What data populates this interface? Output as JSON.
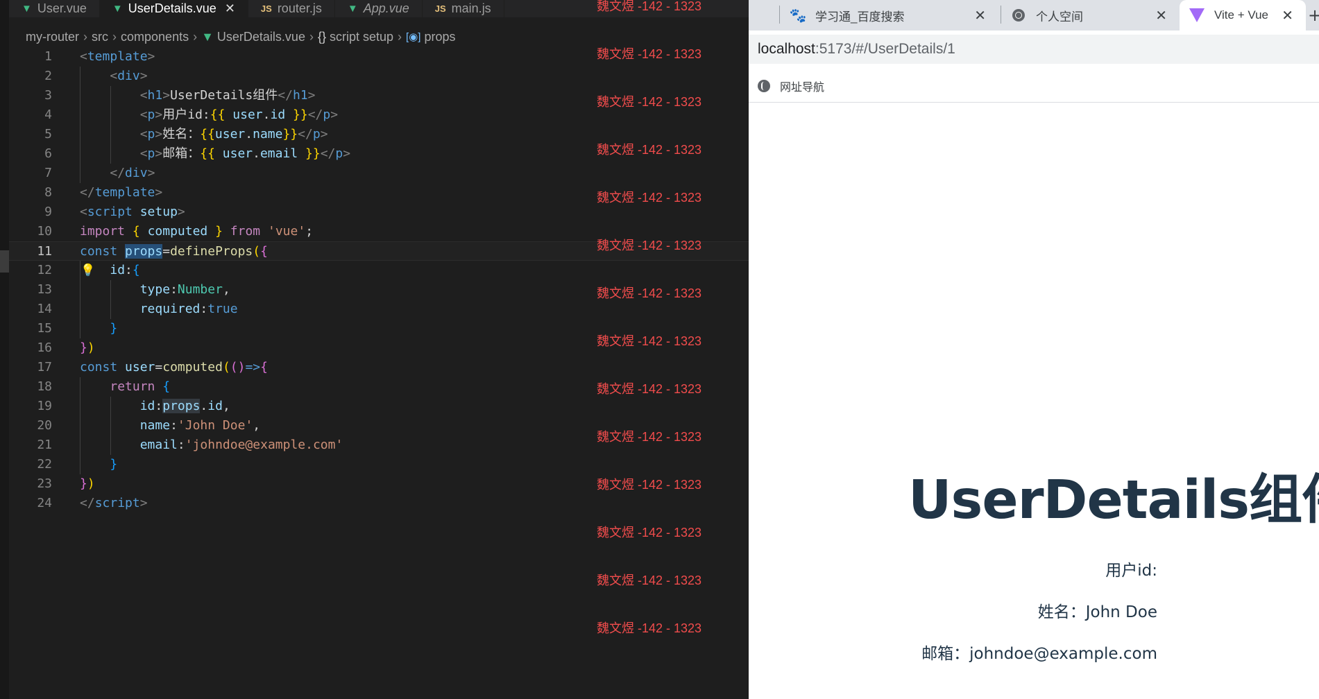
{
  "editor": {
    "tabs": [
      {
        "label": "User.vue",
        "type": "vue",
        "active": false,
        "italic": false
      },
      {
        "label": "UserDetails.vue",
        "type": "vue",
        "active": true,
        "italic": false
      },
      {
        "label": "router.js",
        "type": "js",
        "active": false,
        "italic": false
      },
      {
        "label": "App.vue",
        "type": "vue",
        "active": false,
        "italic": true
      },
      {
        "label": "main.js",
        "type": "js",
        "active": false,
        "italic": false
      }
    ],
    "tab_close_glyph": "✕",
    "breadcrumb": {
      "items": [
        "my-router",
        "src",
        "components"
      ],
      "file": "UserDetails.vue",
      "block": "script setup",
      "symbol": "props"
    },
    "current_line": 11,
    "line_numbers": [
      "1",
      "2",
      "3",
      "4",
      "5",
      "6",
      "7",
      "8",
      "9",
      "10",
      "11",
      "12",
      "13",
      "14",
      "15",
      "16",
      "17",
      "18",
      "19",
      "20",
      "21",
      "22",
      "23",
      "24"
    ],
    "watermark_text": "魏文煜 -142 - 1323",
    "watermark_count": 14
  },
  "browser": {
    "tabs": [
      {
        "title": "学习通_百度搜索",
        "favicon": "baidu-paw-icon"
      },
      {
        "title": "个人空间",
        "favicon": "globe-icon"
      },
      {
        "title": "Vite + Vue",
        "favicon": "vite-icon",
        "active": true
      }
    ],
    "close_glyph": "✕",
    "url_host": "localhost",
    "url_rest": ":5173/#/UserDetails/1",
    "bookmark_label": "网址导航",
    "page": {
      "heading": "UserDetails组件",
      "user_id_label": "用户id:",
      "name_line": "姓名：John Doe",
      "email_line": "邮箱：johndoe@example.com"
    }
  },
  "colors": {
    "editor_bg": "#1e1e1e",
    "watermark": "#f14c4c",
    "vue_green": "#41b883",
    "page_text": "#213547"
  }
}
